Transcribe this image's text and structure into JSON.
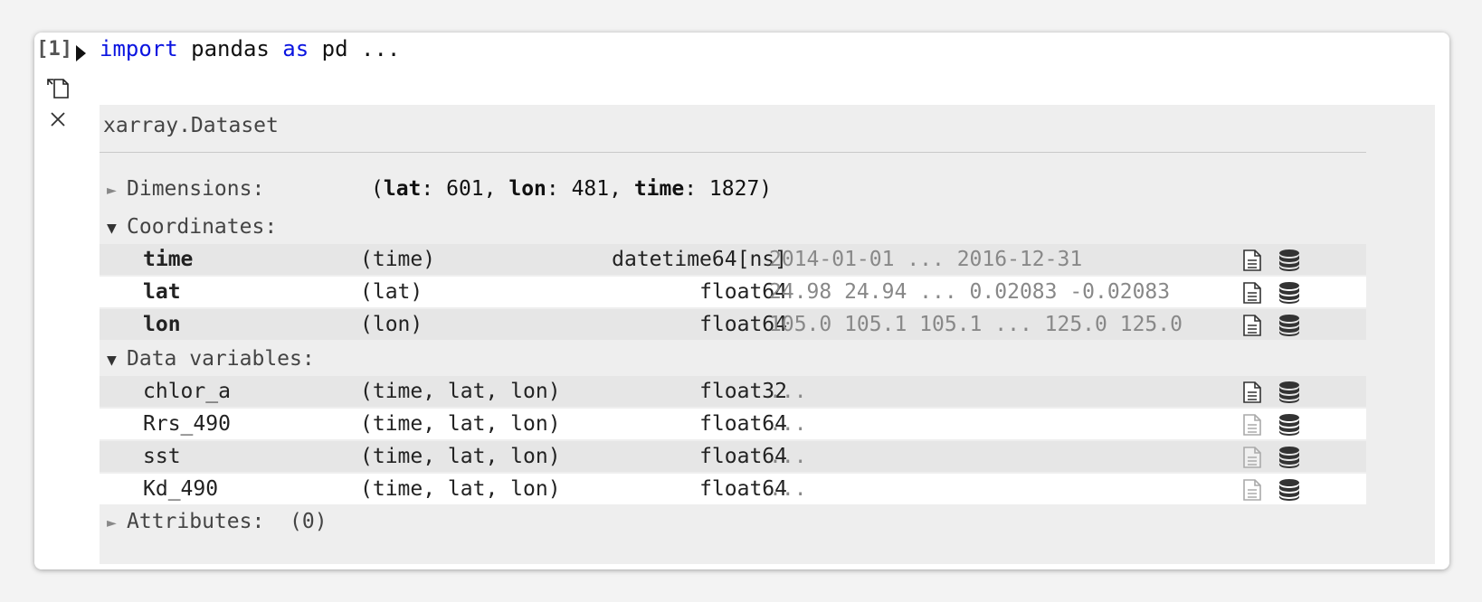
{
  "cell": {
    "prompt": "[1]",
    "code_keyword_import": "import",
    "code_module": " pandas ",
    "code_keyword_as": "as",
    "code_rest": " pd ..."
  },
  "dataset": {
    "title": "xarray.Dataset",
    "dimensions": {
      "label": "Dimensions:",
      "open_paren": "(",
      "lat_name": "lat",
      "lat_value": ": 601, ",
      "lon_name": "lon",
      "lon_value": ": 481, ",
      "time_name": "time",
      "time_value": ": 1827)"
    },
    "coordinates_label": "Coordinates:",
    "coordinates": [
      {
        "name": "time",
        "dims": "(time)",
        "dtype": "datetime64[ns]",
        "preview": "2014-01-01 ... 2016-12-31"
      },
      {
        "name": "lat",
        "dims": "(lat)",
        "dtype": "float64",
        "preview": "24.98 24.94 ... 0.02083 -0.02083"
      },
      {
        "name": "lon",
        "dims": "(lon)",
        "dtype": "float64",
        "preview": "105.0 105.1 105.1 ... 125.0 125.0"
      }
    ],
    "data_vars_label": "Data variables:",
    "data_vars": [
      {
        "name": "chlor_a",
        "dims": "(time, lat, lon)",
        "dtype": "float32",
        "preview": "..."
      },
      {
        "name": "Rrs_490",
        "dims": "(time, lat, lon)",
        "dtype": "float64",
        "preview": "..."
      },
      {
        "name": "sst",
        "dims": "(time, lat, lon)",
        "dtype": "float64",
        "preview": "..."
      },
      {
        "name": "Kd_490",
        "dims": "(time, lat, lon)",
        "dtype": "float64",
        "preview": "..."
      }
    ],
    "attributes_label": "Attributes:",
    "attributes_count": "(0)"
  },
  "icons": {
    "expand_collapsed": "triangle-right-icon",
    "expand_open": "triangle-down-icon",
    "run": "run-triangle-icon",
    "copy_output": "copy-output-icon",
    "clear_output": "close-icon",
    "attrs": "file-text-icon",
    "data": "database-icon"
  }
}
